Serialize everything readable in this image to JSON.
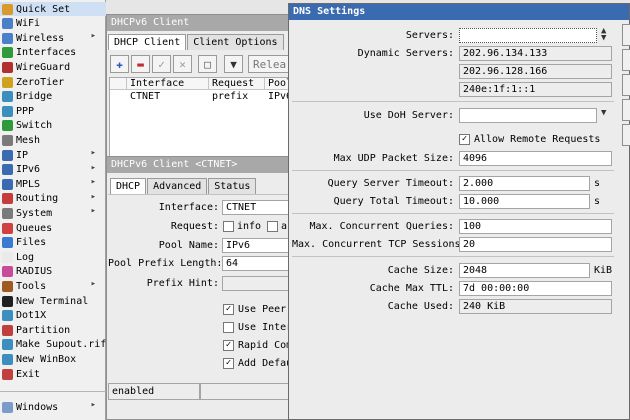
{
  "sidebar": {
    "items": [
      {
        "label": "Quick Set",
        "arrow": false,
        "color": "#d99a2b"
      },
      {
        "label": "WiFi",
        "arrow": false,
        "color": "#4a7fc9"
      },
      {
        "label": "Wireless",
        "arrow": true,
        "color": "#4a7fc9"
      },
      {
        "label": "Interfaces",
        "arrow": false,
        "color": "#2f9a3a"
      },
      {
        "label": "WireGuard",
        "arrow": false,
        "color": "#b03030"
      },
      {
        "label": "ZeroTier",
        "arrow": false,
        "color": "#d0a020"
      },
      {
        "label": "Bridge",
        "arrow": false,
        "color": "#3a8fbf"
      },
      {
        "label": "PPP",
        "arrow": false,
        "color": "#3a8fbf"
      },
      {
        "label": "Switch",
        "arrow": false,
        "color": "#2f9a3a"
      },
      {
        "label": "Mesh",
        "arrow": false,
        "color": "#7a7a7a"
      },
      {
        "label": "IP",
        "arrow": true,
        "color": "#3a6ab0"
      },
      {
        "label": "IPv6",
        "arrow": true,
        "color": "#3a6ab0"
      },
      {
        "label": "MPLS",
        "arrow": true,
        "color": "#3a6ab0"
      },
      {
        "label": "Routing",
        "arrow": true,
        "color": "#c43c3c"
      },
      {
        "label": "System",
        "arrow": true,
        "color": "#7a7a7a"
      },
      {
        "label": "Queues",
        "arrow": false,
        "color": "#d04040"
      },
      {
        "label": "Files",
        "arrow": false,
        "color": "#3a7ad0"
      },
      {
        "label": "Log",
        "arrow": false,
        "color": "#eaeaea"
      },
      {
        "label": "RADIUS",
        "arrow": false,
        "color": "#c94a9a"
      },
      {
        "label": "Tools",
        "arrow": true,
        "color": "#a05a20"
      },
      {
        "label": "New Terminal",
        "arrow": false,
        "color": "#202020"
      },
      {
        "label": "Dot1X",
        "arrow": false,
        "color": "#3a8fbf"
      },
      {
        "label": "Partition",
        "arrow": false,
        "color": "#c04040"
      },
      {
        "label": "Make Supout.rif",
        "arrow": false,
        "color": "#3a8fbf"
      },
      {
        "label": "New WinBox",
        "arrow": false,
        "color": "#3a8fbf"
      },
      {
        "label": "Exit",
        "arrow": false,
        "color": "#c04040"
      }
    ],
    "windows_label": "Windows"
  },
  "dhcp_list": {
    "title": "DHCPv6 Client",
    "tabs": [
      "DHCP Client",
      "Client Options"
    ],
    "release_label": "Relea",
    "columns": [
      "Interface",
      "Request",
      "Pool"
    ],
    "row": {
      "interface": "CTNET",
      "request": "prefix",
      "pool": "IPv6"
    }
  },
  "dhcp_detail": {
    "title": "DHCPv6 Client <CTNET>",
    "tabs": [
      "DHCP",
      "Advanced",
      "Status"
    ],
    "interface_label": "Interface:",
    "interface_value": "CTNET",
    "request_label": "Request:",
    "request_info": "info",
    "request_a": "a",
    "pool_name_label": "Pool Name:",
    "pool_name_value": "IPv6",
    "prefix_len_label": "Pool Prefix Length:",
    "prefix_len_value": "64",
    "prefix_hint_label": "Prefix Hint:",
    "chk_use_peer": "Use Peer",
    "chk_use_inter": "Use Inter",
    "chk_rapid": "Rapid Com",
    "chk_add_default": "Add Defau",
    "status_text": "enabled"
  },
  "dns": {
    "title": "DNS Settings",
    "servers_label": "Servers:",
    "dynamic_servers_label": "Dynamic Servers:",
    "dynamic_servers": [
      "202.96.134.133",
      "202.96.128.166",
      "240e:1f:1::1"
    ],
    "doh_label": "Use DoH Server:",
    "allow_remote_label": "Allow Remote Requests",
    "max_udp_label": "Max UDP Packet Size:",
    "max_udp_value": "4096",
    "query_server_label": "Query Server Timeout:",
    "query_server_value": "2.000",
    "query_total_label": "Query Total Timeout:",
    "query_total_value": "10.000",
    "seconds_unit": "s",
    "max_queries_label": "Max. Concurrent Queries:",
    "max_queries_value": "100",
    "max_tcp_label": "Max. Concurrent TCP Sessions:",
    "max_tcp_value": "20",
    "cache_size_label": "Cache Size:",
    "cache_size_value": "2048",
    "cache_size_unit": "KiB",
    "cache_ttl_label": "Cache Max TTL:",
    "cache_ttl_value": "7d 00:00:00",
    "cache_used_label": "Cache Used:",
    "cache_used_value": "240 KiB"
  }
}
